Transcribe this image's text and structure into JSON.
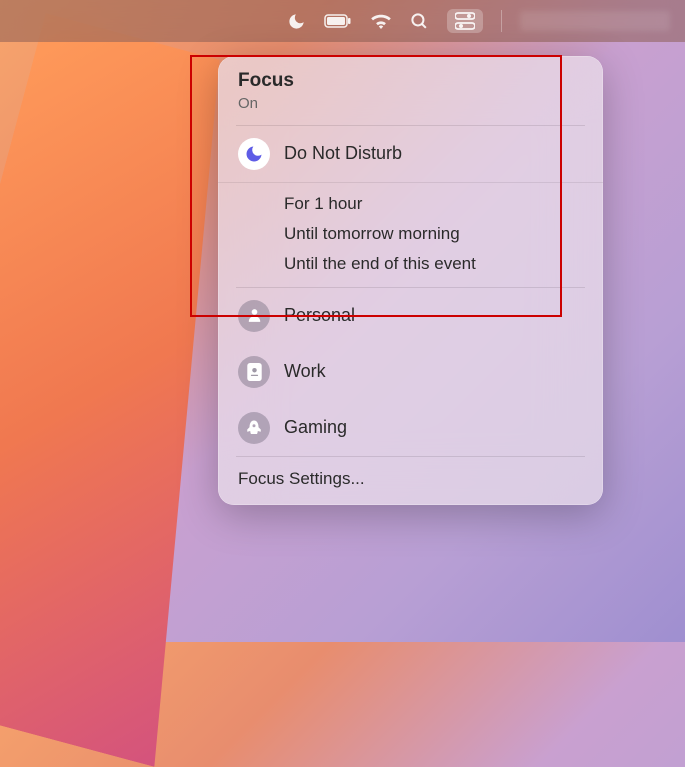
{
  "menubar": {
    "icons": [
      "focus-moon",
      "battery",
      "wifi",
      "search",
      "control-center"
    ],
    "date_blurred": true
  },
  "panel": {
    "title": "Focus",
    "subtitle": "On",
    "dnd": {
      "label": "Do Not Disturb",
      "active": true
    },
    "durations": [
      "For 1 hour",
      "Until tomorrow morning",
      "Until the end of this event"
    ],
    "modes": [
      {
        "label": "Personal",
        "icon": "person"
      },
      {
        "label": "Work",
        "icon": "badge"
      },
      {
        "label": "Gaming",
        "icon": "rocket"
      }
    ],
    "settings_label": "Focus Settings..."
  }
}
